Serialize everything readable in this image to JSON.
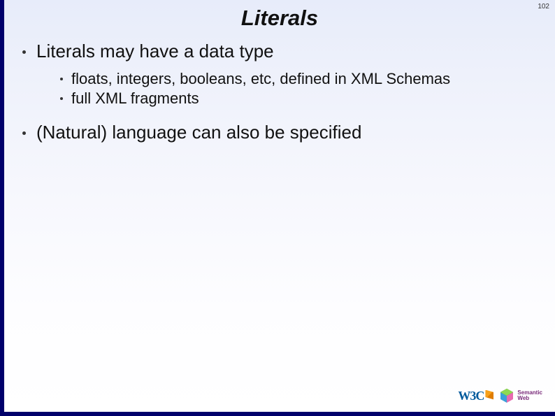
{
  "page_number": "102",
  "title": "Literals",
  "bullets": {
    "items": [
      {
        "text": "Literals may have a data type",
        "sub": [
          {
            "text": "floats, integers, booleans, etc, defined in XML Schemas"
          },
          {
            "text": "full XML fragments"
          }
        ]
      },
      {
        "text": "(Natural) language can also be specified",
        "sub": []
      }
    ]
  },
  "logos": {
    "w3c": "W3C",
    "semantic_web": {
      "line1": "Semantic",
      "line2": "Web"
    }
  }
}
